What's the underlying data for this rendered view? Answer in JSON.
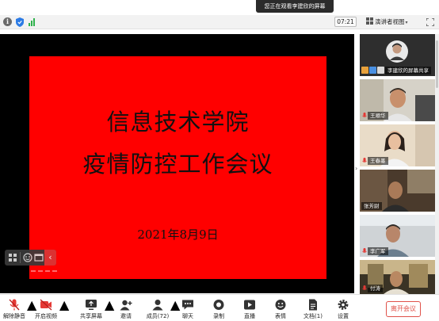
{
  "banner": {
    "text": "您正在观看李建欣的屏幕"
  },
  "info_bar": {
    "timer": "07:21",
    "view_label": "演讲者视图",
    "icons": [
      "info-icon",
      "shield-icon",
      "signal-icon",
      "fullscreen-icon"
    ]
  },
  "slide": {
    "title_line1": "信息技术学院",
    "title_line2": "疫情防控工作会议",
    "date": "2021年8月9日"
  },
  "participants": [
    {
      "name": "李建欣的屏幕共享"
    },
    {
      "name": "王顺华"
    },
    {
      "name": "王春墨"
    },
    {
      "name": "张芳尉"
    },
    {
      "name": "李广军"
    },
    {
      "name": "付涛"
    }
  ],
  "toolbar": {
    "mute": "解除静音",
    "video": "开启视频",
    "share": "共享屏幕",
    "invite": "邀请",
    "members": "成员(72)",
    "chat": "聊天",
    "record": "录制",
    "live": "直播",
    "emoji": "表情",
    "docs": "文档(1)",
    "settings": "设置",
    "leave": "离开会议"
  },
  "colors": {
    "slide_bg": "#ff0000",
    "leave": "#e0524a",
    "mute_icon": "#e53935",
    "signal": "#2fb24c"
  }
}
